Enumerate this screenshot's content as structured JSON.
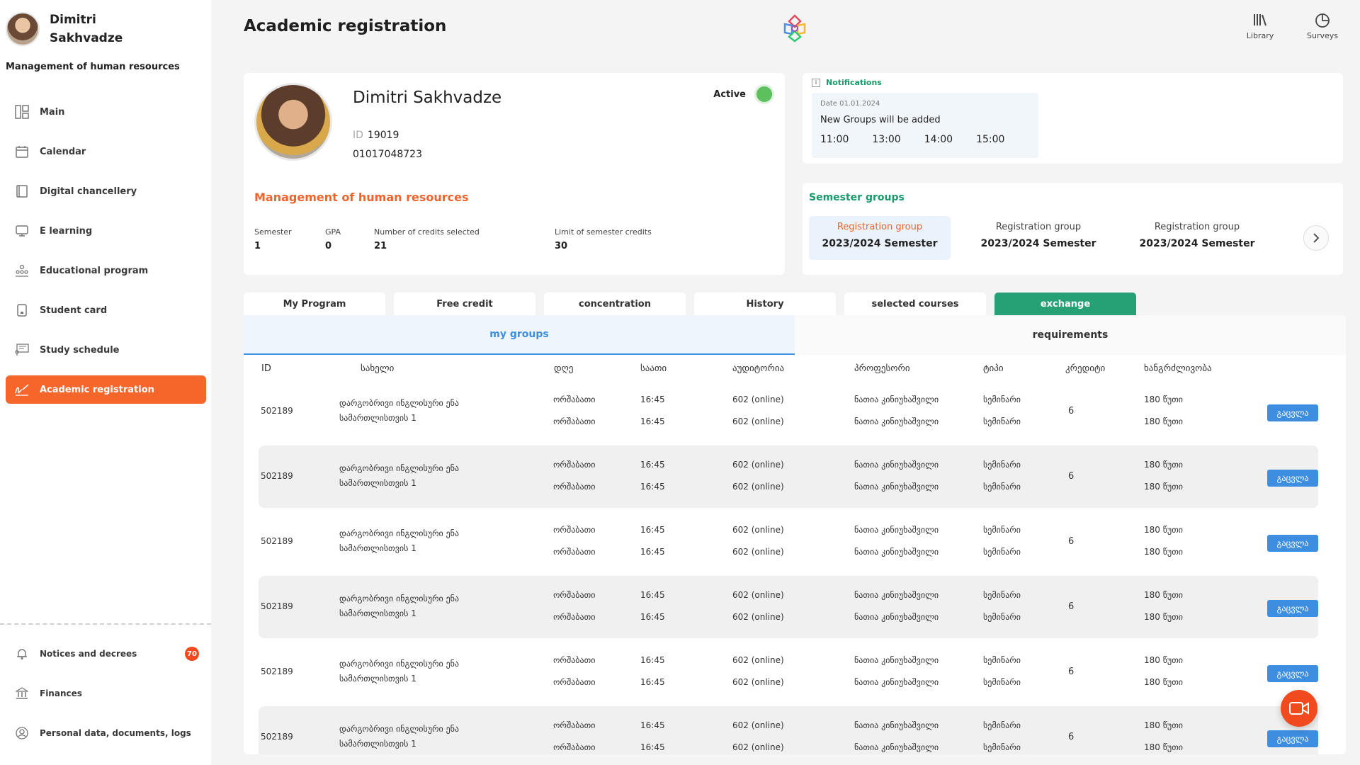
{
  "user": {
    "name": "Dimitri Sakhvadze",
    "department": "Management of human resources"
  },
  "nav": [
    {
      "label": "Main",
      "icon": "layout-icon"
    },
    {
      "label": "Calendar",
      "icon": "calendar-icon"
    },
    {
      "label": "Digital chancellery",
      "icon": "book-icon"
    },
    {
      "label": "E learning",
      "icon": "monitor-icon"
    },
    {
      "label": "Educational program",
      "icon": "people-icon"
    },
    {
      "label": "Student card",
      "icon": "card-icon"
    },
    {
      "label": "Study schedule",
      "icon": "presentation-icon"
    },
    {
      "label": "Academic registration",
      "icon": "signature-icon"
    }
  ],
  "nav_bottom": [
    {
      "label": "Notices and decrees",
      "badge": "70"
    },
    {
      "label": "Finances"
    },
    {
      "label": "Personal data, documents, logs"
    }
  ],
  "header": {
    "title": "Academic registration",
    "library": "Library",
    "surveys": "Surveys"
  },
  "profile": {
    "name": "Dimitri Sakhvadze",
    "id_label": "ID",
    "id": "19019",
    "personal_number": "01017048723",
    "status": "Active",
    "department": "Management of human resources",
    "stats": [
      {
        "label": "Semester",
        "value": "1"
      },
      {
        "label": "GPA",
        "value": "0"
      },
      {
        "label": "Number of credits selected",
        "value": "21"
      },
      {
        "label": "Limit of semester credits",
        "value": "30"
      }
    ]
  },
  "notifications": {
    "title": "Notifications",
    "date": "Date 01.01.2024",
    "text": "New Groups will be added",
    "times": [
      "11:00",
      "13:00",
      "14:00",
      "15:00"
    ]
  },
  "semester_groups": {
    "title": "Semester groups",
    "items": [
      {
        "label": "Registration group",
        "semester": "2023/2024 Semester"
      },
      {
        "label": "Registration group",
        "semester": "2023/2024 Semester"
      },
      {
        "label": "Registration group",
        "semester": "2023/2024 Semester"
      }
    ]
  },
  "tabs": [
    "My Program",
    "Free credit",
    "concentration",
    "History",
    "selected courses",
    "exchange"
  ],
  "subtabs": [
    "my groups",
    "requirements"
  ],
  "table": {
    "headers": [
      "ID",
      "სახელი",
      "დღე",
      "საათი",
      "აუდიტორია",
      "პროფესორი",
      "ტიპი",
      "კრედიტი",
      "ხანგრძლივობა"
    ],
    "rows": [
      {
        "id": "502189",
        "name1": "დარგობრივი ინგლისური ენა",
        "name2": "სამართლისთვის 1",
        "day": "ორშაბათი",
        "time": "16:45",
        "room": "602 (online)",
        "prof": "ნათია კინიუხაშვილი",
        "type": "სემინარი",
        "credit": "6",
        "duration": "180 წუთი",
        "action": "გაცვლა"
      },
      {
        "id": "502189",
        "name1": "დარგობრივი ინგლისური ენა",
        "name2": "სამართლისთვის 1",
        "day": "ორშაბათი",
        "time": "16:45",
        "room": "602 (online)",
        "prof": "ნათია კინიუხაშვილი",
        "type": "სემინარი",
        "credit": "6",
        "duration": "180 წუთი",
        "action": "გაცვლა"
      },
      {
        "id": "502189",
        "name1": "დარგობრივი ინგლისური ენა",
        "name2": "სამართლისთვის 1",
        "day": "ორშაბათი",
        "time": "16:45",
        "room": "602 (online)",
        "prof": "ნათია კინიუხაშვილი",
        "type": "სემინარი",
        "credit": "6",
        "duration": "180 წუთი",
        "action": "გაცვლა"
      },
      {
        "id": "502189",
        "name1": "დარგობრივი ინგლისური ენა",
        "name2": "სამართლისთვის 1",
        "day": "ორშაბათი",
        "time": "16:45",
        "room": "602 (online)",
        "prof": "ნათია კინიუხაშვილი",
        "type": "სემინარი",
        "credit": "6",
        "duration": "180 წუთი",
        "action": "გაცვლა"
      },
      {
        "id": "502189",
        "name1": "დარგობრივი ინგლისური ენა",
        "name2": "სამართლისთვის 1",
        "day": "ორშაბათი",
        "time": "16:45",
        "room": "602 (online)",
        "prof": "ნათია კინიუხაშვილი",
        "type": "სემინარი",
        "credit": "6",
        "duration": "180 წუთი",
        "action": "გაცვლა"
      },
      {
        "id": "502189",
        "name1": "დარგობრივი ინგლისური ენა",
        "name2": "სამართლისთვის 1",
        "day": "ორშაბათი",
        "time": "16:45",
        "room": "602 (online)",
        "prof": "ნათია კინიუხაშვილი",
        "type": "სემინარი",
        "credit": "6",
        "duration": "180 წუთი",
        "action": "გაცვლა"
      }
    ]
  },
  "colors": {
    "accent": "#f6662b",
    "green": "#26a176",
    "blue": "#3d8de0"
  }
}
